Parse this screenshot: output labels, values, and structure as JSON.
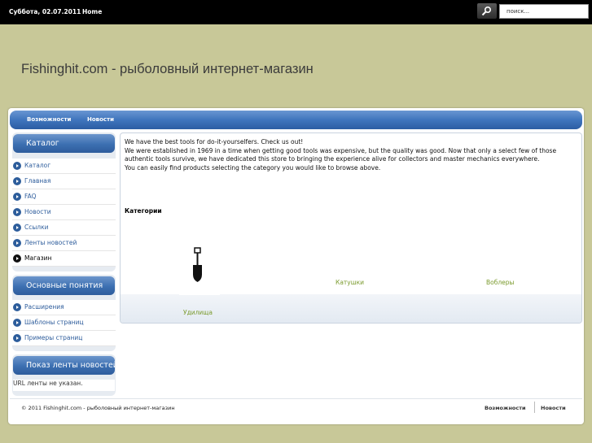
{
  "topbar": {
    "date": "Суббота, 02.07.2011",
    "home_label": "Home",
    "search_icon": "search-icon",
    "search_value": "поиск..."
  },
  "site_title": "Fishinghit.com - рыболовный интернет-магазин",
  "nav": {
    "items": [
      {
        "label": "Возможности"
      },
      {
        "label": "Новости"
      }
    ]
  },
  "sidebar": {
    "catalog": {
      "title": "Каталог",
      "items": [
        {
          "label": "Каталог"
        },
        {
          "label": "Главная"
        },
        {
          "label": "FAQ"
        },
        {
          "label": "Новости"
        },
        {
          "label": "Ссылки"
        },
        {
          "label": "Ленты новостей"
        },
        {
          "label": "Магазин",
          "active": true
        }
      ]
    },
    "concepts": {
      "title": "Основные понятия",
      "items": [
        {
          "label": "Расширения"
        },
        {
          "label": "Шаблоны страниц"
        },
        {
          "label": "Примеры страниц"
        }
      ]
    },
    "feed": {
      "title": "Показ ленты новостей",
      "text": "URL ленты не указан."
    }
  },
  "content": {
    "intro": [
      "We have the best tools for do-it-yourselfers. Check us out!",
      "We were established in 1969 in a time when getting good tools was expensive, but the quality was good. Now that only a select few of those",
      "authentic tools survive, we have dedicated this store to bringing the experience alive for collectors and master mechanics everywhere.",
      "You can easily find products selecting the category you would like to browse above."
    ],
    "categories_heading": "Категории",
    "categories": [
      {
        "label": "Удилища",
        "icon": "shovel-icon"
      },
      {
        "label": "Катушки"
      },
      {
        "label": "Воблеры"
      }
    ]
  },
  "footer": {
    "copyright": "© 2011 Fishinghit.com - рыболовный интернет-магазин",
    "links": [
      {
        "label": "Возможности"
      },
      {
        "label": "Новости"
      }
    ]
  },
  "colors": {
    "background": "#c8c898",
    "accent_blue": "#3f75bd",
    "link_green": "#7a9a2c"
  }
}
